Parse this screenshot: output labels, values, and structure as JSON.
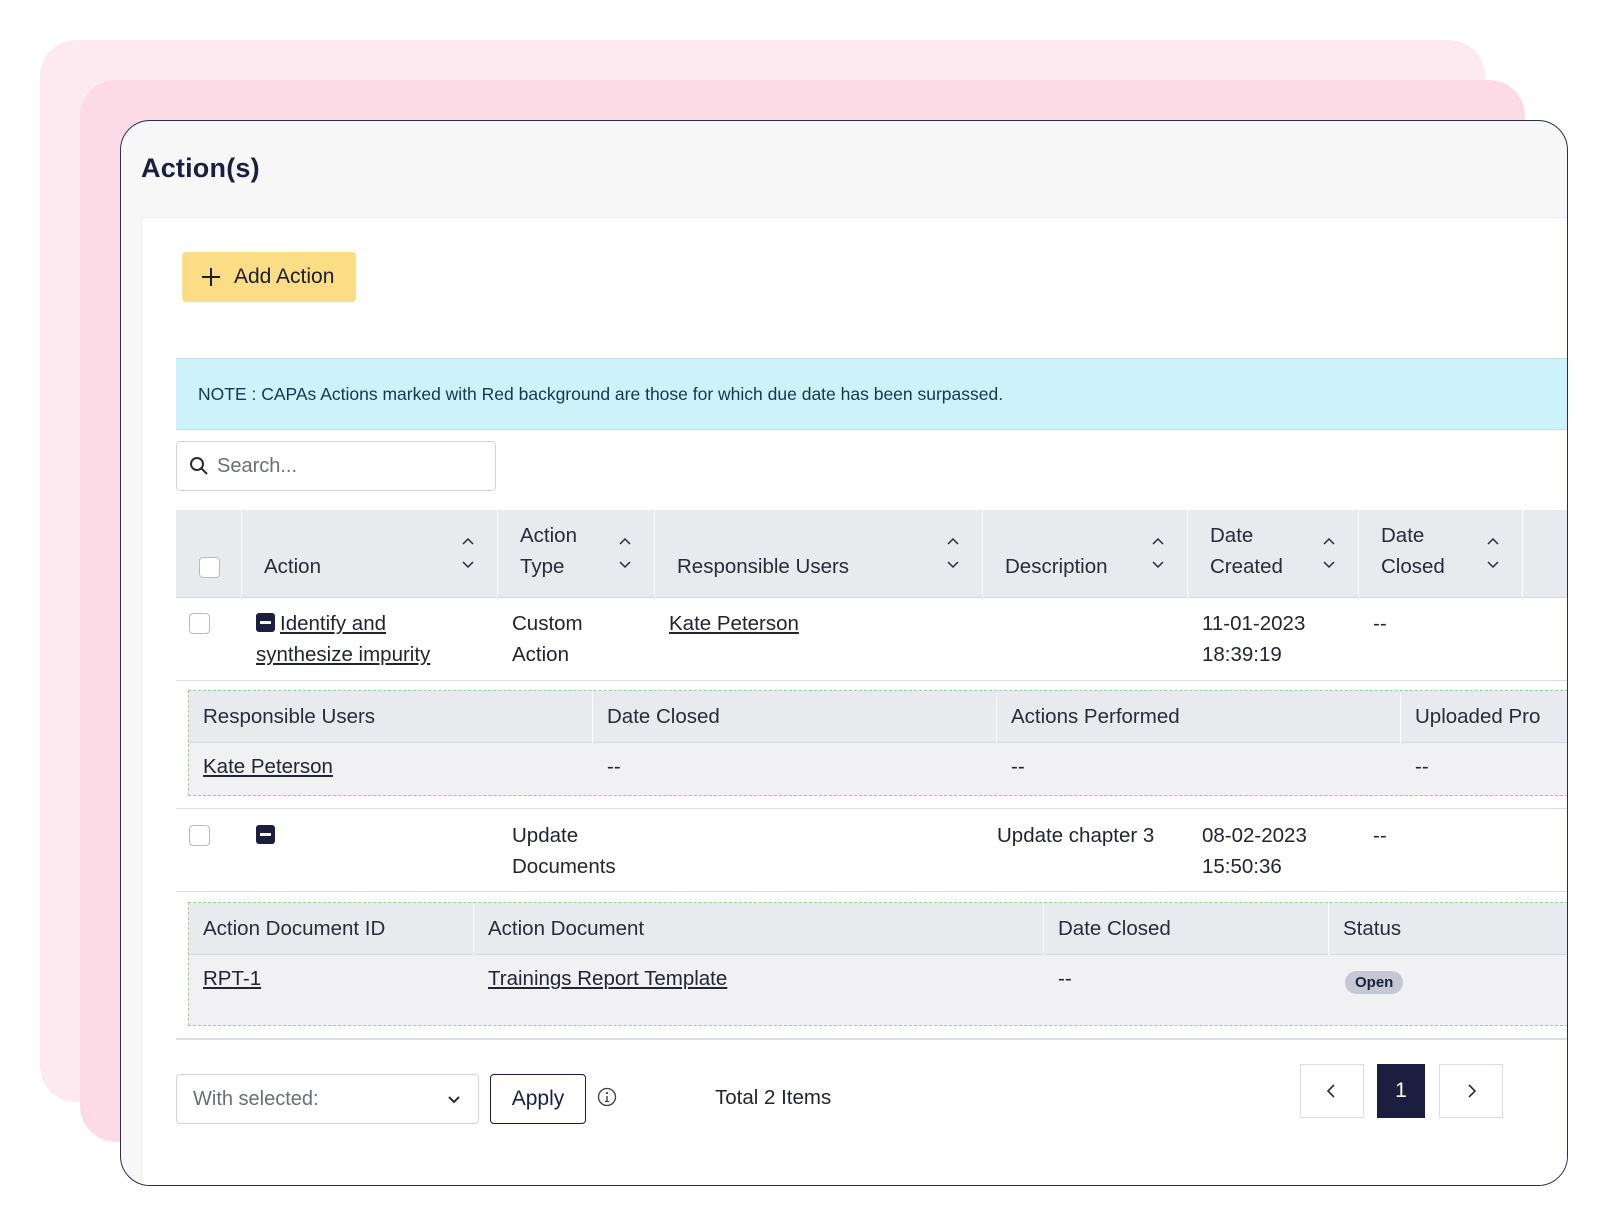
{
  "title": "Action(s)",
  "add_action_label": "Add Action",
  "note": "NOTE : CAPAs Actions marked with Red background are those for which due date has been surpassed.",
  "search": {
    "placeholder": "Search..."
  },
  "columns": [
    "Action",
    "Action Type",
    "Responsible Users",
    "Description",
    "Date Created",
    "Date Closed"
  ],
  "rows": [
    {
      "action": "Identify and synthesize impurity",
      "action_type": "Custom Action",
      "responsible_users": "Kate Peterson",
      "description": "",
      "date_created": "11-01-2023 18:39:19",
      "date_closed": "--",
      "sub": {
        "columns": [
          "Responsible Users",
          "Date Closed",
          "Actions Performed",
          "Uploaded Pro"
        ],
        "values": [
          "Kate Peterson",
          "--",
          "--",
          "--"
        ]
      }
    },
    {
      "action": "",
      "action_type": "Update Documents",
      "responsible_users": "",
      "description": "Update chapter 3",
      "date_created": "08-02-2023 15:50:36",
      "date_closed": "--",
      "sub": {
        "columns": [
          "Action Document ID",
          "Action Document",
          "Date Closed",
          "Status"
        ],
        "values": [
          "RPT-1",
          "Trainings Report Template",
          "--",
          "Open"
        ]
      }
    }
  ],
  "footer": {
    "with_selected": "With selected:",
    "apply": "Apply",
    "total": "Total 2 Items",
    "current_page": "1"
  },
  "colors": {
    "accent_yellow": "#fbdd86",
    "note_bg": "#cdf2fa",
    "navy": "#1b1e3f",
    "dashed_green": "#8fd68b"
  }
}
